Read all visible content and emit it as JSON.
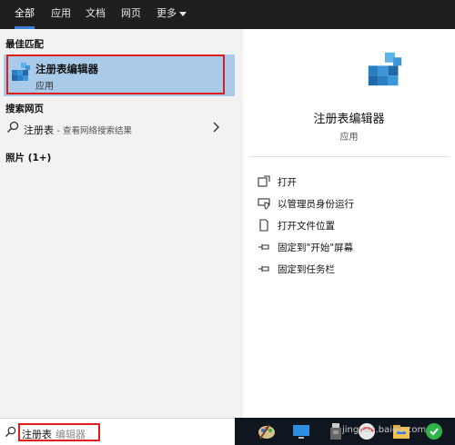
{
  "tabs": [
    {
      "label": "全部",
      "active": true
    },
    {
      "label": "应用",
      "active": false
    },
    {
      "label": "文档",
      "active": false
    },
    {
      "label": "网页",
      "active": false
    },
    {
      "label": "更多",
      "active": false
    }
  ],
  "left": {
    "best_match_heading": "最佳匹配",
    "best_match": {
      "title": "注册表编辑器",
      "subtitle": "应用",
      "icon": "registry-editor-icon"
    },
    "web_heading": "搜索网页",
    "web_result": {
      "main": "注册表",
      "hint": "- 查看网络搜索结果"
    },
    "photos_heading": "照片 (1+)"
  },
  "right": {
    "app_name": "注册表编辑器",
    "app_type": "应用",
    "actions": [
      {
        "label": "打开",
        "icon": "open-icon"
      },
      {
        "label": "以管理员身份运行",
        "icon": "shield-icon"
      },
      {
        "label": "打开文件位置",
        "icon": "file-location-icon"
      },
      {
        "label": "固定到\"开始\"屏幕",
        "icon": "pin-icon"
      },
      {
        "label": "固定到任务栏",
        "icon": "pin-icon"
      }
    ]
  },
  "search": {
    "typed": "注册表",
    "suggestion": "编辑器"
  },
  "watermark": "jingyan.baidu.com",
  "colors": {
    "selected": "#a9cae8",
    "highlight_box": "#e01d1d",
    "accent": "#3d7fd6"
  }
}
